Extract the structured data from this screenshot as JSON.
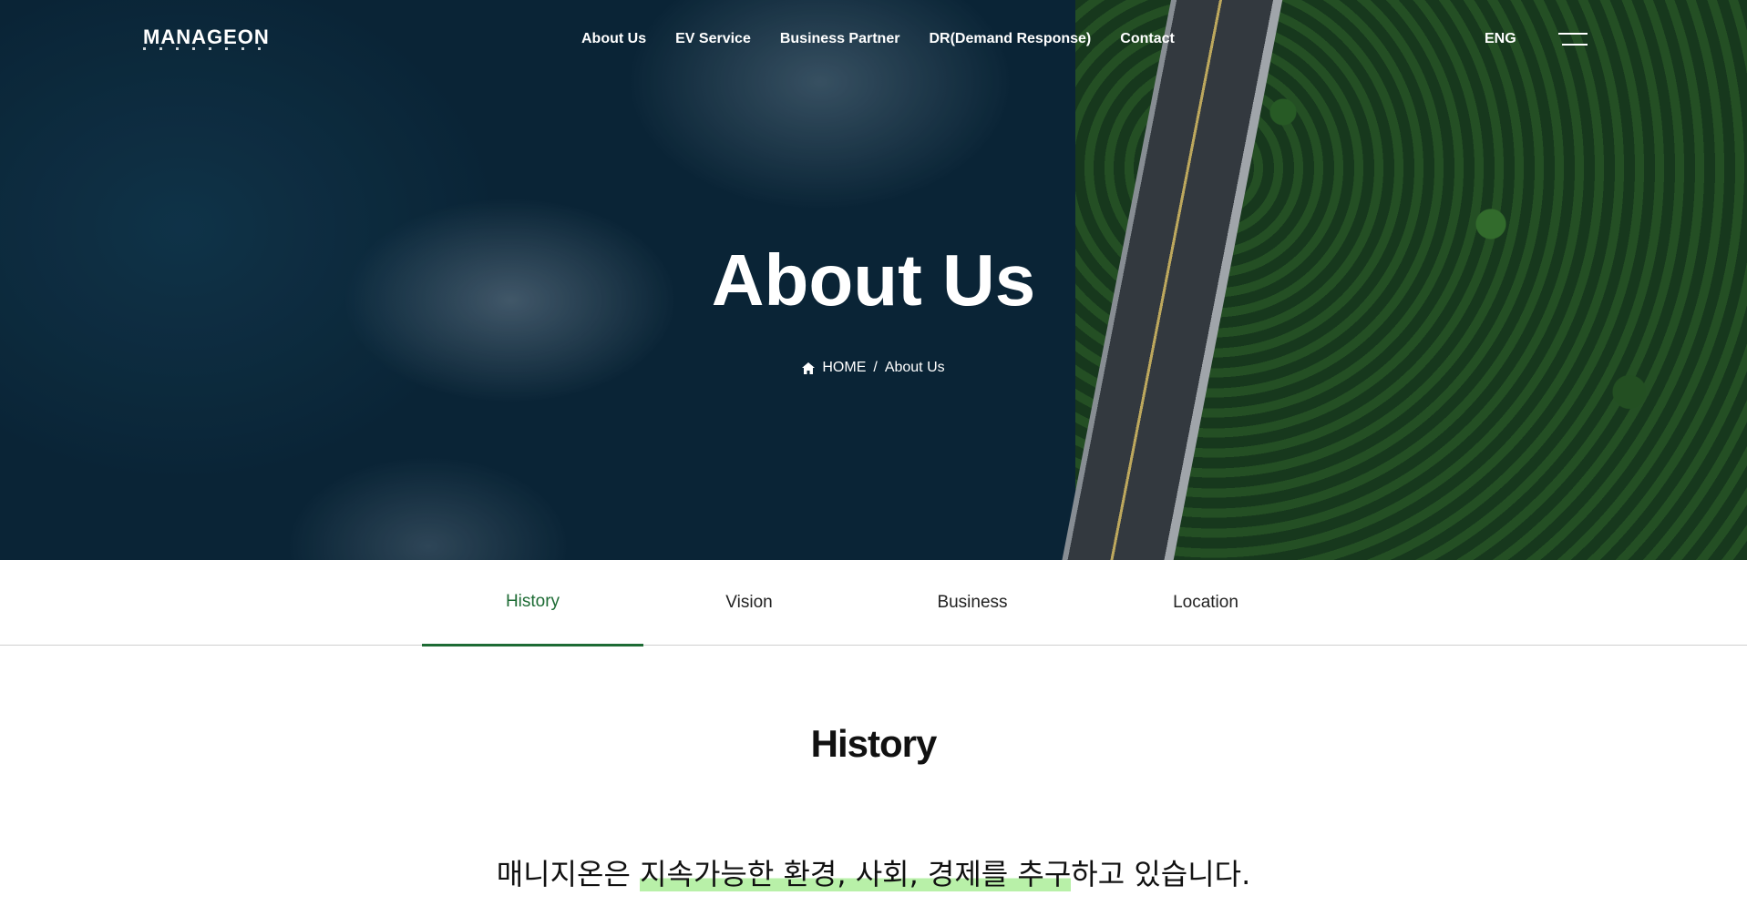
{
  "brand": {
    "logo_text": "MANAGEON"
  },
  "nav": {
    "items": [
      "About Us",
      "EV Service",
      "Business Partner",
      "DR(Demand Response)",
      "Contact"
    ],
    "lang": "ENG"
  },
  "hero": {
    "title": "About Us",
    "breadcrumb": {
      "home": "HOME",
      "separator": "/",
      "current": "About Us"
    }
  },
  "tabs": {
    "items": [
      "History",
      "Vision",
      "Business",
      "Location"
    ],
    "active": "History"
  },
  "content": {
    "title": "History",
    "intro_before": "매니지온은 ",
    "intro_highlight": "지속가능한 환경, 사회, 경제를 추구",
    "intro_after": "하고 있습니다."
  },
  "colors": {
    "accent": "#1d6b34",
    "highlight": "#b8f0a8"
  },
  "icons": {
    "home": "home-icon",
    "menu": "hamburger-menu-icon"
  }
}
